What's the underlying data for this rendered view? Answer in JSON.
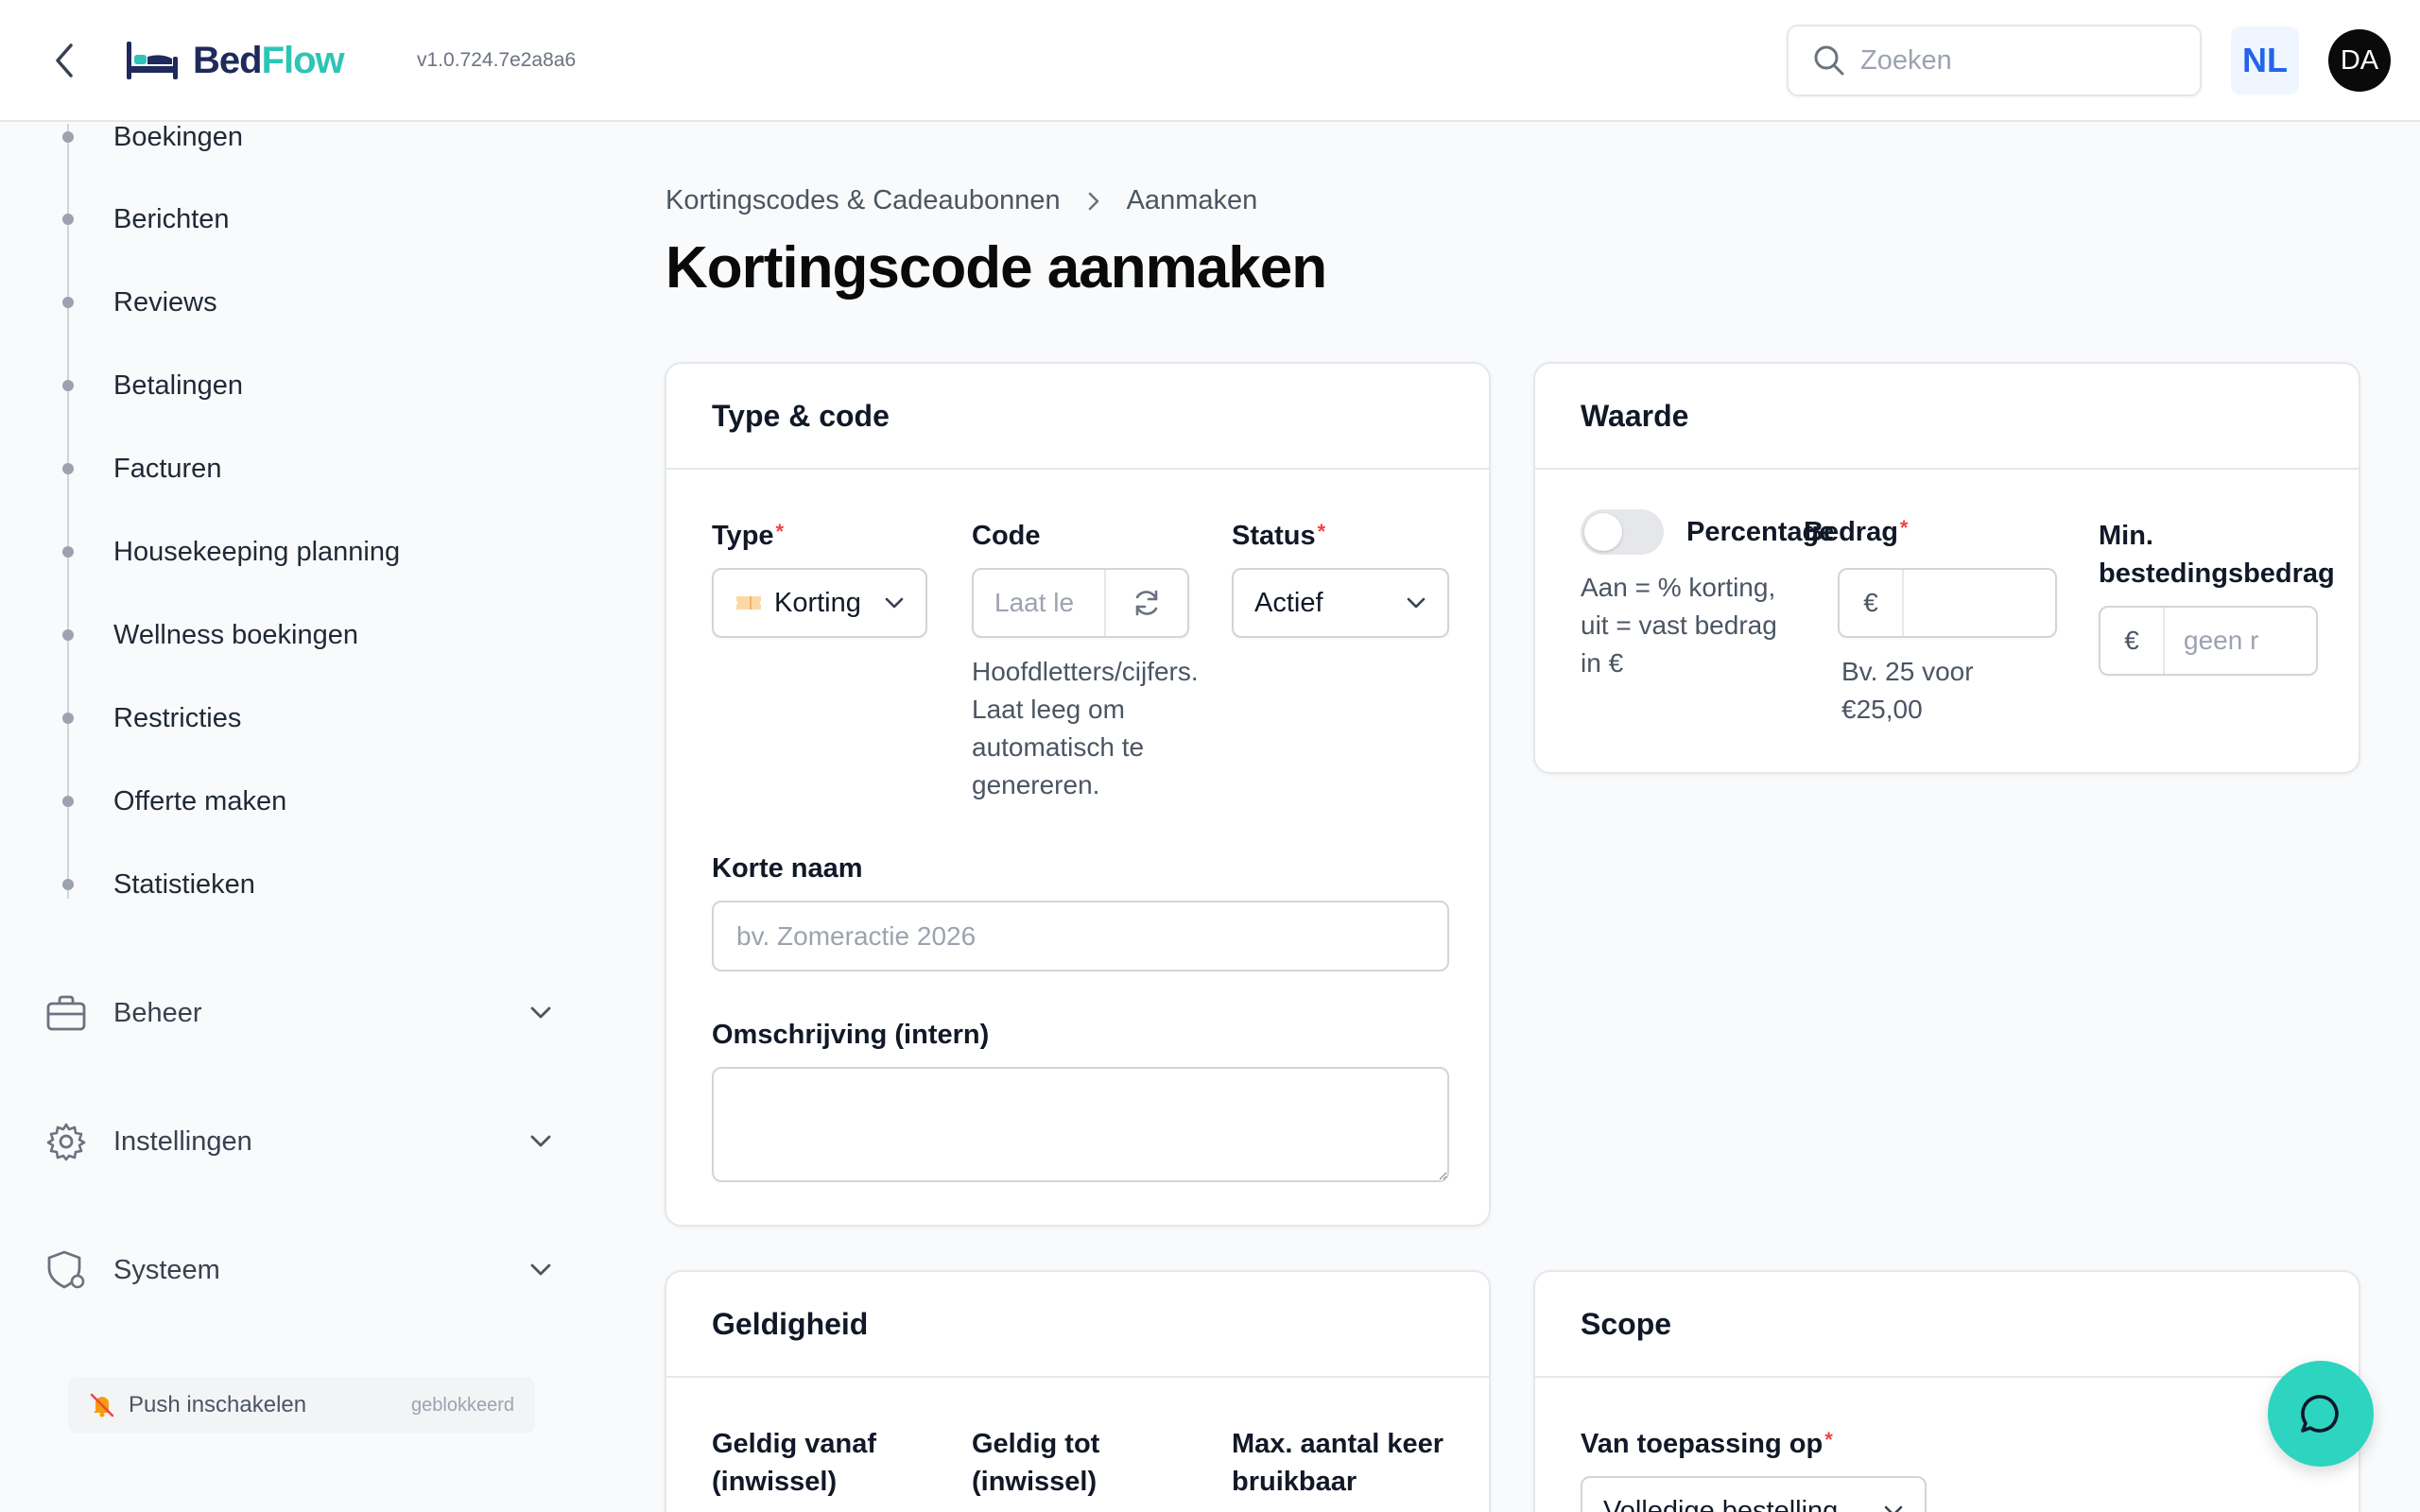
{
  "header": {
    "logo_bed": "Bed",
    "logo_flow": "Flow",
    "version": "v1.0.724.7e2a8a6",
    "search_placeholder": "Zoeken",
    "language": "NL",
    "avatar_initials": "DA"
  },
  "sidebar": {
    "items": [
      {
        "label": "Boekingen"
      },
      {
        "label": "Berichten"
      },
      {
        "label": "Reviews"
      },
      {
        "label": "Betalingen"
      },
      {
        "label": "Facturen"
      },
      {
        "label": "Housekeeping planning"
      },
      {
        "label": "Wellness boekingen"
      },
      {
        "label": "Restricties"
      },
      {
        "label": "Offerte maken"
      },
      {
        "label": "Statistieken"
      }
    ],
    "groups": [
      {
        "label": "Beheer",
        "icon": "briefcase-icon"
      },
      {
        "label": "Instellingen",
        "icon": "gear-icon"
      },
      {
        "label": "Systeem",
        "icon": "shield-gear-icon"
      }
    ],
    "push": {
      "label": "Push inschakelen",
      "status": "geblokkeerd"
    }
  },
  "breadcrumb": {
    "parent": "Kortingscodes & Cadeaubonnen",
    "current": "Aanmaken"
  },
  "page_title": "Kortingscode aanmaken",
  "type_code_card": {
    "title": "Type & code",
    "type_label": "Type",
    "type_value": "Korting",
    "code_label": "Code",
    "code_placeholder": "Laat le",
    "code_help": [
      "Hoofdletters/cijfers.",
      "Laat leeg om",
      "automatisch te",
      "genereren."
    ],
    "status_label": "Status",
    "status_value": "Actief",
    "short_name_label": "Korte naam",
    "short_name_placeholder": "bv. Zomeractie 2026",
    "description_label": "Omschrijving (intern)"
  },
  "value_card": {
    "title": "Waarde",
    "toggle_label": "Percentage",
    "toggle_help": [
      "Aan = % korting,",
      "uit = vast bedrag",
      "in €"
    ],
    "toggle_on": false,
    "amount_label": "Bedrag",
    "amount_prefix": "€",
    "amount_help": [
      "Bv. 25 voor",
      "€25,00"
    ],
    "min_label_1": "Min.",
    "min_label_2": "bestedingsbedrag",
    "min_prefix": "€",
    "min_placeholder": "geen r"
  },
  "validity_card": {
    "title": "Geldigheid",
    "from_label": [
      "Geldig vanaf",
      "(inwissel)"
    ],
    "to_label": [
      "Geldig tot",
      "(inwissel)"
    ],
    "max_label": [
      "Max. aantal keer",
      "bruikbaar"
    ]
  },
  "scope_card": {
    "title": "Scope",
    "applies_label": "Van toepassing op",
    "applies_value": "Volledige bestelling"
  },
  "colors": {
    "brand_dark": "#1e2a5a",
    "brand_accent": "#2ec4b6",
    "required": "#ef4444",
    "chat_fab": "#2dd4bf"
  }
}
